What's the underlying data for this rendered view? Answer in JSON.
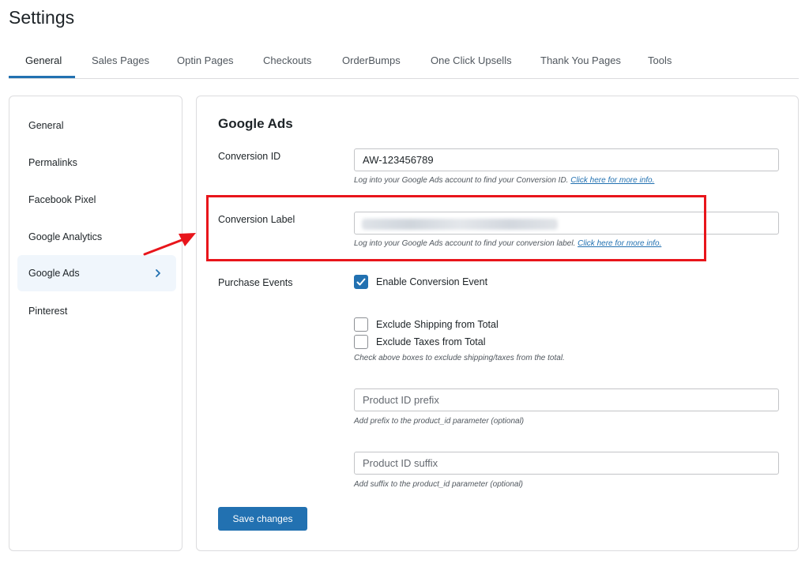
{
  "page": {
    "title": "Settings"
  },
  "tabs": [
    {
      "label": "General",
      "active": true
    },
    {
      "label": "Sales Pages"
    },
    {
      "label": "Optin Pages"
    },
    {
      "label": "Checkouts"
    },
    {
      "label": "OrderBumps"
    },
    {
      "label": "One Click Upsells"
    },
    {
      "label": "Thank You Pages"
    },
    {
      "label": "Tools"
    }
  ],
  "sidebar": {
    "items": [
      {
        "label": "General"
      },
      {
        "label": "Permalinks"
      },
      {
        "label": "Facebook Pixel"
      },
      {
        "label": "Google Analytics"
      },
      {
        "label": "Google Ads",
        "active": true,
        "icon": "chevron-right-icon"
      },
      {
        "label": "Pinterest"
      }
    ]
  },
  "panel": {
    "title": "Google Ads",
    "conversion_id": {
      "label": "Conversion ID",
      "value": "AW-123456789",
      "help": "Log into your Google Ads account to find your Conversion ID.",
      "link": "Click here for more info."
    },
    "conversion_label": {
      "label": "Conversion Label",
      "value_state": "blurred",
      "help": "Log into your Google Ads account to find your conversion label.",
      "link": "Click here for more info."
    },
    "purchase_events": {
      "label": "Purchase Events",
      "enable_conversion": {
        "label": "Enable Conversion Event",
        "checked": true
      },
      "exclude_shipping": {
        "label": "Exclude Shipping from Total",
        "checked": false
      },
      "exclude_taxes": {
        "label": "Exclude Taxes from Total",
        "checked": false
      },
      "help": "Check above boxes to exclude shipping/taxes from the total."
    },
    "product_prefix": {
      "placeholder": "Product ID prefix",
      "help": "Add prefix to the product_id parameter (optional)"
    },
    "product_suffix": {
      "placeholder": "Product ID suffix",
      "help": "Add suffix to the product_id parameter (optional)"
    },
    "save_label": "Save changes"
  },
  "colors": {
    "accent": "#2271b1",
    "annotation_red": "#e8151b",
    "active_bg": "#f0f6fc"
  }
}
